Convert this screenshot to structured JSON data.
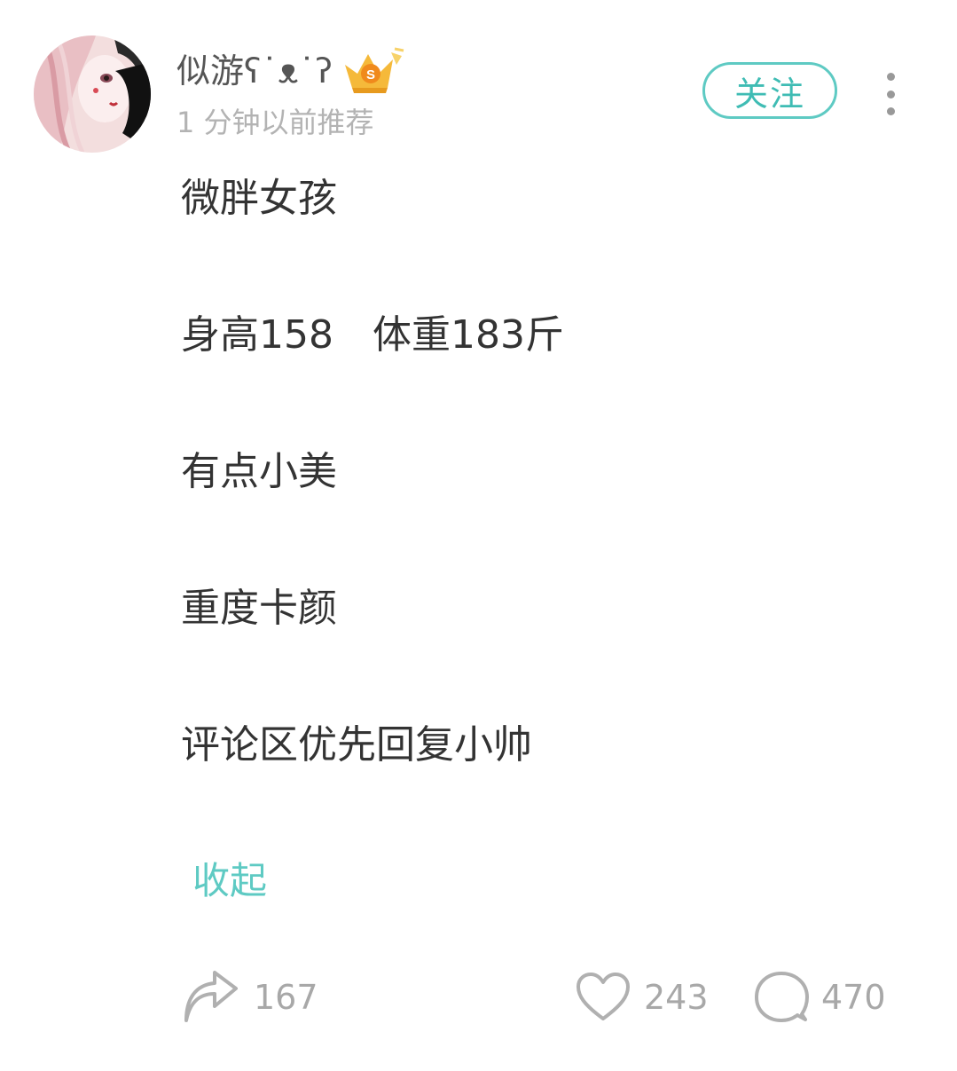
{
  "post": {
    "author": {
      "name": "似游ʕ˙ᴥ˙ʔ",
      "avatar_icon": "anime-girl-avatar",
      "badge_icon": "vip-crown-badge-icon"
    },
    "time": "1 分钟以前推荐",
    "follow_label": "关注",
    "more_icon": "more-vertical-icon",
    "lines": [
      "微胖女孩",
      "身高158　体重183斤",
      "有点小美",
      "重度卡颜",
      "评论区优先回复小帅"
    ],
    "collapse_label": "收起",
    "actions": {
      "share_count": "167",
      "like_count": "243",
      "comment_count": "470"
    }
  },
  "colors": {
    "accent": "#5ecac3",
    "text": "#333333",
    "muted": "#b3b3b3",
    "icon": "#b0b0b0"
  }
}
